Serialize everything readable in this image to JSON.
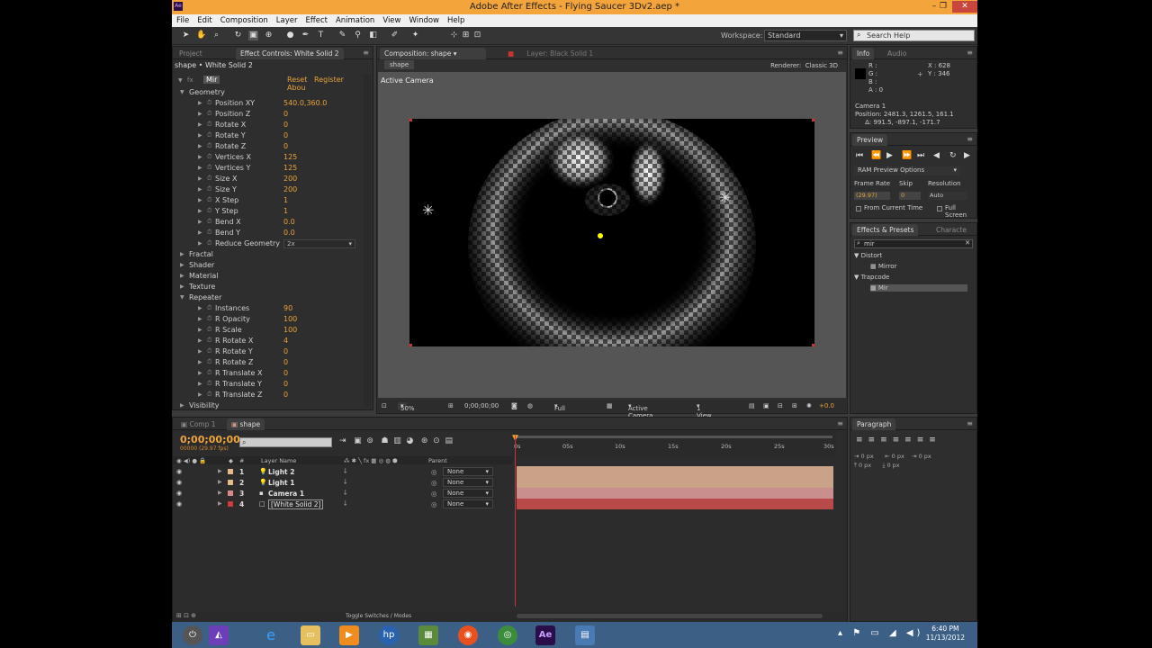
{
  "window": {
    "title": "Adobe After Effects - Flying Saucer 3Dv2.aep *",
    "min": "–",
    "max": "❐",
    "close": "✕",
    "app_badge": "Ae"
  },
  "menu": [
    "File",
    "Edit",
    "Composition",
    "Layer",
    "Effect",
    "Animation",
    "View",
    "Window",
    "Help"
  ],
  "toolbar": {
    "workspace_label": "Workspace:",
    "workspace_value": "Standard",
    "search_placeholder": "Search Help"
  },
  "project_panel": {
    "tabs": [
      "Project",
      "Effect Controls: White Solid 2"
    ],
    "subtitle": "shape • White Solid 2",
    "effect": {
      "name": "Mir",
      "reset": "Reset",
      "register": "Register",
      "about": "Abou"
    },
    "rows": [
      {
        "label": "Geometry",
        "type": "group-open",
        "indent": 1
      },
      {
        "label": "Position XY",
        "value": "540.0,360.0",
        "type": "prop"
      },
      {
        "label": "Position Z",
        "value": "0",
        "type": "prop"
      },
      {
        "label": "Rotate X",
        "value": "0",
        "type": "prop"
      },
      {
        "label": "Rotate Y",
        "value": "0",
        "type": "prop"
      },
      {
        "label": "Rotate Z",
        "value": "0",
        "type": "prop"
      },
      {
        "label": "Vertices X",
        "value": "125",
        "type": "prop"
      },
      {
        "label": "Vertices Y",
        "value": "125",
        "type": "prop"
      },
      {
        "label": "Size X",
        "value": "200",
        "type": "prop"
      },
      {
        "label": "Size Y",
        "value": "200",
        "type": "prop"
      },
      {
        "label": "X Step",
        "value": "1",
        "type": "prop"
      },
      {
        "label": "Y Step",
        "value": "1",
        "type": "prop"
      },
      {
        "label": "Bend X",
        "value": "0.0",
        "type": "prop"
      },
      {
        "label": "Bend Y",
        "value": "0.0",
        "type": "prop"
      },
      {
        "label": "Reduce Geometry",
        "value": "2x",
        "type": "dropdown"
      },
      {
        "label": "Fractal",
        "type": "group"
      },
      {
        "label": "Shader",
        "type": "group"
      },
      {
        "label": "Material",
        "type": "group"
      },
      {
        "label": "Texture",
        "type": "group"
      },
      {
        "label": "Repeater",
        "type": "group-open"
      },
      {
        "label": "Instances",
        "value": "90",
        "type": "prop"
      },
      {
        "label": "R Opacity",
        "value": "100",
        "type": "prop"
      },
      {
        "label": "R Scale",
        "value": "100",
        "type": "prop"
      },
      {
        "label": "R Rotate X",
        "value": "4",
        "type": "prop"
      },
      {
        "label": "R Rotate Y",
        "value": "0",
        "type": "prop"
      },
      {
        "label": "R Rotate Z",
        "value": "0",
        "type": "prop"
      },
      {
        "label": "R Translate X",
        "value": "0",
        "type": "prop"
      },
      {
        "label": "R Translate Y",
        "value": "0",
        "type": "prop"
      },
      {
        "label": "R Translate Z",
        "value": "0",
        "type": "prop"
      },
      {
        "label": "Visibility",
        "type": "group"
      }
    ]
  },
  "composition": {
    "tabs": [
      "Composition: shape",
      "Layer: Black Solid 1"
    ],
    "subtab": "shape",
    "renderer_label": "Renderer:",
    "renderer_value": "Classic 3D",
    "camera_label": "Active Camera",
    "footer": {
      "zoom": "50%",
      "timecode": "0;00;00;00",
      "resolution": "Full",
      "view": "Active Camera",
      "views": "1 View",
      "exposure": "+0.0"
    }
  },
  "info_panel": {
    "tabs": [
      "Info",
      "Audio"
    ],
    "rgb": "R :\nG :\nB :\nA : 0",
    "xy": "X : 628\nY : 346",
    "camera": "Camera 1\nPosition: 2481.3, 1261.5, 161.1\n     Δ: 991.5, -897.1, -171.7"
  },
  "preview_panel": {
    "tab": "Preview",
    "ram_options": "RAM Preview Options",
    "frame_rate_label": "Frame Rate",
    "skip_label": "Skip",
    "resolution_label": "Resolution",
    "frame_rate": "(29.97)",
    "skip": "0",
    "resolution": "Auto",
    "from_current": "From Current Time",
    "full_screen": "Full Screen"
  },
  "effects_presets": {
    "tabs": [
      "Effects & Presets",
      "Characte"
    ],
    "search": "mir",
    "tree": [
      {
        "label": "Distort",
        "type": "folder"
      },
      {
        "label": "Mirror",
        "type": "item"
      },
      {
        "label": "Trapcode",
        "type": "folder"
      },
      {
        "label": "Mir",
        "type": "item-selected"
      }
    ]
  },
  "timeline": {
    "tabs": [
      "Comp 1",
      "shape"
    ],
    "timecode": "0;00;00;00",
    "fps": "00000 (29.97 fps)",
    "columns": {
      "num": "#",
      "name": "Layer Name",
      "parent": "Parent"
    },
    "ruler": [
      "0s",
      "05s",
      "10s",
      "15s",
      "20s",
      "25s",
      "30s"
    ],
    "layers": [
      {
        "num": "1",
        "name": "Light 2",
        "icon": "💡",
        "swatch": "#e7b98a",
        "parent": "None",
        "bar": "#c9a287"
      },
      {
        "num": "2",
        "name": "Light 1",
        "icon": "💡",
        "swatch": "#e7b98a",
        "parent": "None",
        "bar": "#c9a287"
      },
      {
        "num": "3",
        "name": "Camera 1",
        "icon": "▪",
        "swatch": "#d88a8a",
        "parent": "None",
        "bar": "#c98e8e"
      },
      {
        "num": "4",
        "name": "[White Solid 2]",
        "icon": "□",
        "swatch": "#cc3b3b",
        "parent": "None",
        "bar": "#b84a4a"
      }
    ],
    "footer": "Toggle Switches / Modes"
  },
  "paragraph_panel": {
    "tab": "Paragraph",
    "px": [
      "0 px",
      "0 px",
      "0 px",
      "0 px",
      "0 px"
    ]
  },
  "taskbar": {
    "time": "6:40 PM",
    "date": "11/13/2012"
  }
}
